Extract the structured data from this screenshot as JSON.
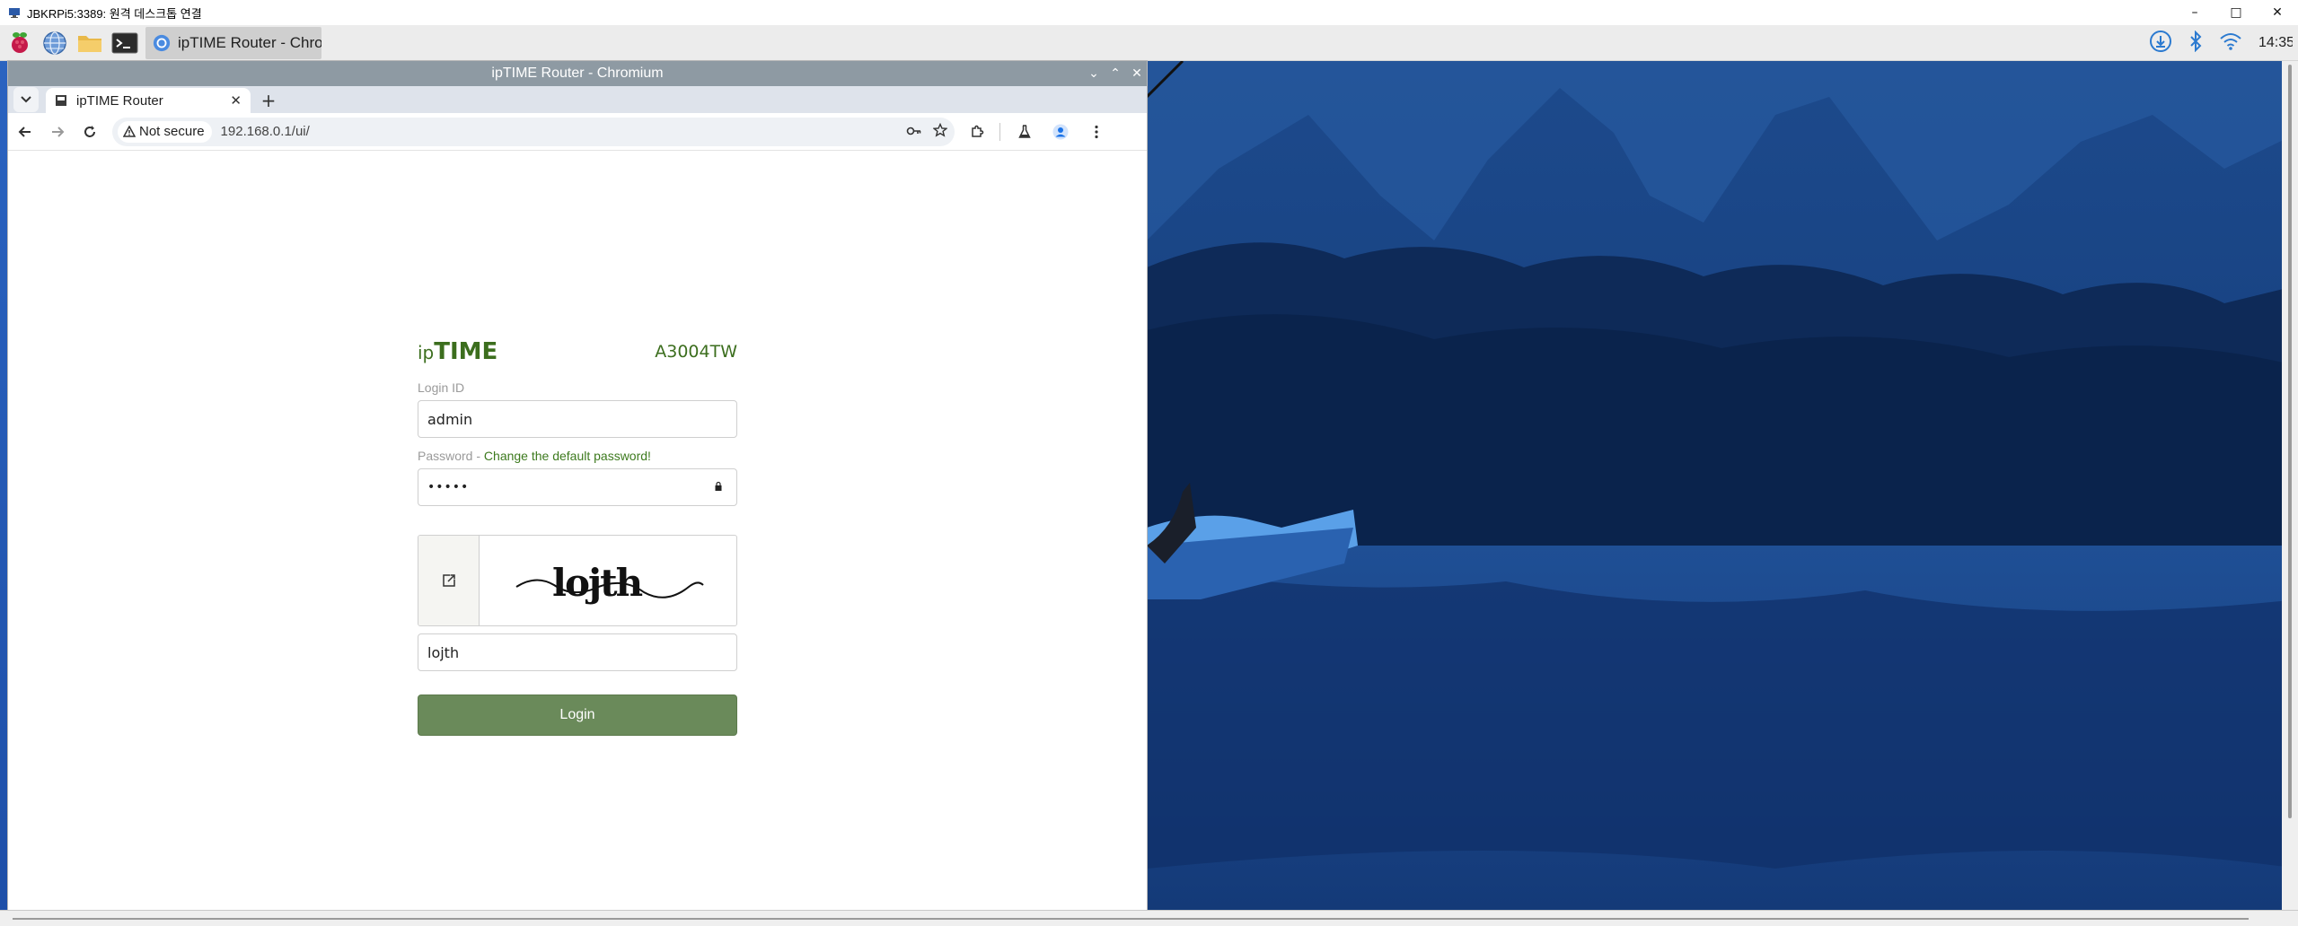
{
  "rdp": {
    "title": "JBKRPi5:3389: 원격 데스크톱 연결"
  },
  "taskbar": {
    "icons": [
      "raspberry-icon",
      "globe-icon",
      "folder-icon",
      "terminal-icon"
    ],
    "active_task_label": "ipTIME Router - Chro...",
    "tray_icons": [
      "download-icon",
      "bluetooth-icon",
      "wifi-icon"
    ],
    "clock": "14:35"
  },
  "browser": {
    "window_title": "ipTIME Router - Chromium",
    "tab": {
      "title": "ipTIME Router"
    },
    "new_tab_label": "+",
    "security_label": "Not secure",
    "url": "192.168.0.1/ui/"
  },
  "login": {
    "logo_ip": "ip",
    "logo_time": "TIME",
    "model": "A3004TW",
    "login_id_label": "Login ID",
    "login_id_value": "admin",
    "password_label_prefix": "Password - ",
    "password_warning": "Change the default password!",
    "password_masked": "•••••",
    "captcha_text": "lojth",
    "captcha_input_value": "lojth",
    "login_button": "Login"
  },
  "colors": {
    "brand_green": "#3c6e1e",
    "login_button": "#6a8a5a",
    "chrome_titlebar": "#8e9aa3"
  }
}
